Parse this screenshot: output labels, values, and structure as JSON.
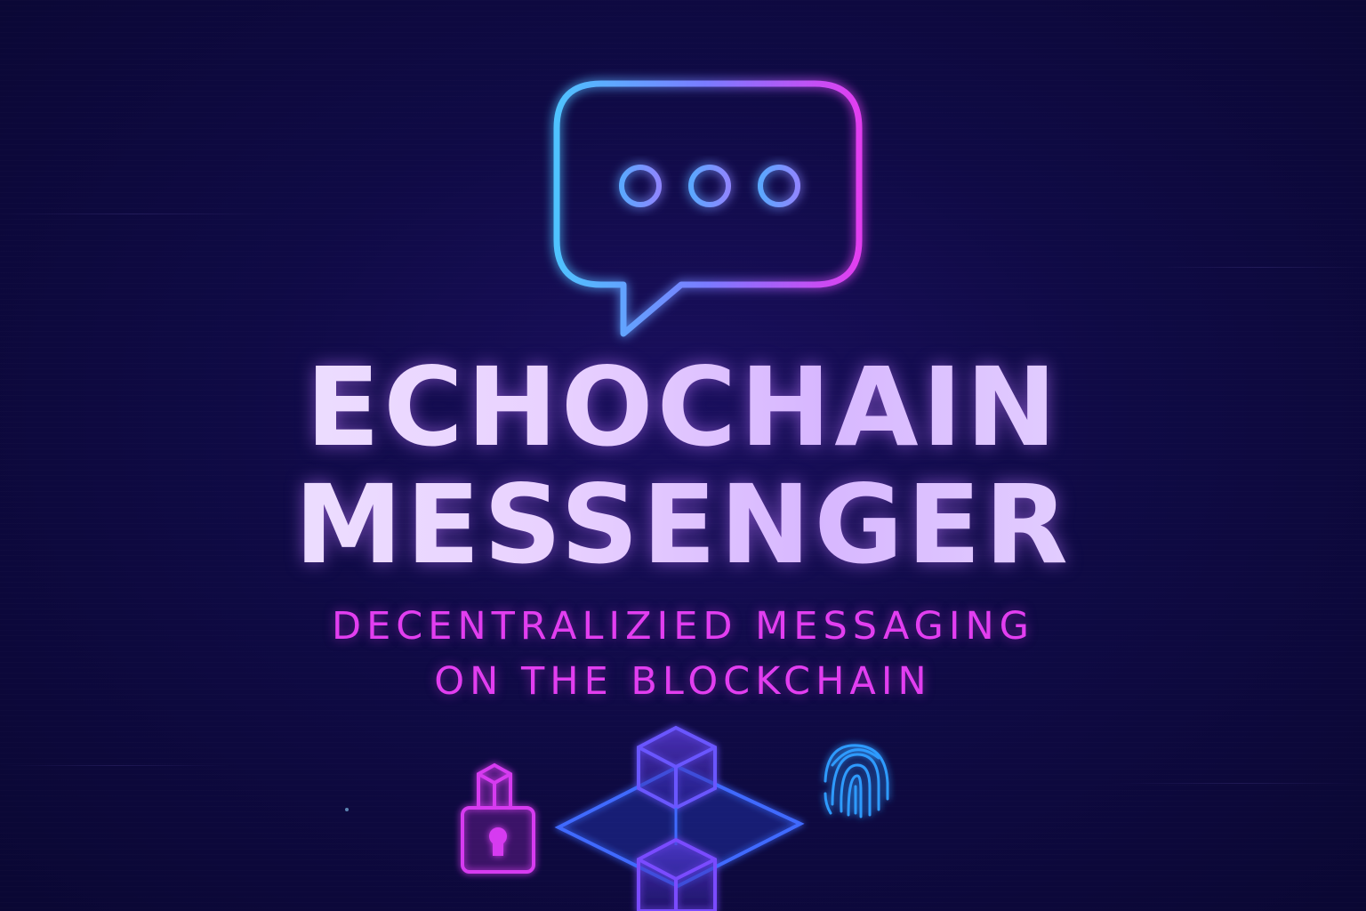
{
  "title": {
    "line1": "ECHOCHAIN",
    "line2": "MESSENGER"
  },
  "tagline": {
    "line1": "DECENTRALIZIED MESSAGING",
    "line2": "ON THE BLOCKCHAIN"
  },
  "icons": [
    "chat-bubble-icon",
    "padlock-icon",
    "blockchain-cubes-icon",
    "fingerprint-icon"
  ],
  "colors": {
    "background": "#0f0a45",
    "accent_blue": "#4fc3ff",
    "accent_magenta": "#e23ef0",
    "title_text": "#ece3ff"
  }
}
